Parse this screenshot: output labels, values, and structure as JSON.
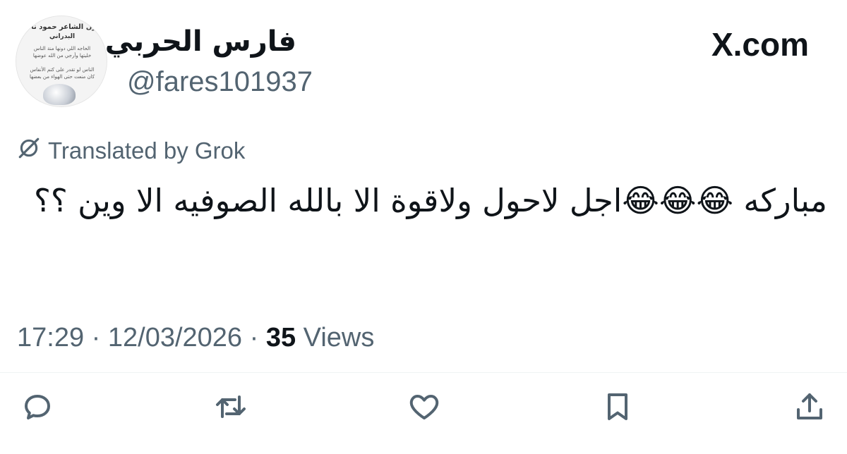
{
  "header": {
    "display_name": "فارس الحربي",
    "handle": "@fares1‌01937",
    "brand": "X.com",
    "avatar": {
      "line1": "يقول الشاعر حمود ناصر",
      "line2": "البدراني",
      "line3": "الحاجه اللي دونها منة الناس",
      "line4": "خليتها وأرجي من الله عوضها",
      "line5": "الناس لو تقدر على كتم الأنفاس",
      "line6": "كان منعت حتى الهواء من بعضها"
    }
  },
  "translation": {
    "label": "Translated by Grok",
    "icon": "grok-icon"
  },
  "tweet": {
    "text": "مباركه 😂😂😂اجل لاحول ولاقوة الا بالله الصوفيه الا وين ؟؟"
  },
  "meta": {
    "time": "17:29",
    "separator": " · ",
    "date": "12/03/2026",
    "separator2": " · ",
    "views_count": "35",
    "views_label": " Views"
  },
  "actions": [
    {
      "name": "reply",
      "icon": "reply-icon"
    },
    {
      "name": "repost",
      "icon": "repost-icon"
    },
    {
      "name": "like",
      "icon": "heart-icon"
    },
    {
      "name": "bookmark",
      "icon": "bookmark-icon"
    },
    {
      "name": "share",
      "icon": "share-icon"
    }
  ],
  "colors": {
    "text_primary": "#0f1419",
    "text_secondary": "#536471",
    "background": "#ffffff"
  }
}
